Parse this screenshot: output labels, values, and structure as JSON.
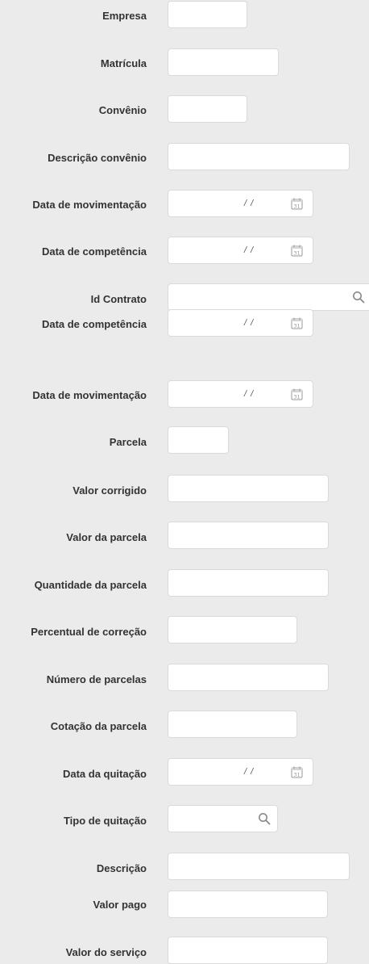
{
  "form": {
    "empresa": {
      "label": "Empresa",
      "value": ""
    },
    "matricula": {
      "label": "Matrícula",
      "value": ""
    },
    "convenio": {
      "label": "Convênio",
      "value": ""
    },
    "descricao_convenio": {
      "label": "Descrição convênio",
      "value": ""
    },
    "data_movimentacao_1": {
      "label": "Data de movimentação",
      "value": " / /"
    },
    "data_competencia_1": {
      "label": "Data de competência",
      "value": " / /"
    },
    "id_contrato": {
      "label": "Id Contrato",
      "value": ""
    },
    "data_competencia_2": {
      "label": "Data de competência",
      "value": " / /"
    },
    "data_movimentacao_2": {
      "label": "Data de movimentação",
      "value": " / /"
    },
    "parcela": {
      "label": "Parcela",
      "value": ""
    },
    "valor_corrigido": {
      "label": "Valor corrigido",
      "value": ""
    },
    "valor_parcela": {
      "label": "Valor da parcela",
      "value": ""
    },
    "quantidade_parcela": {
      "label": "Quantidade da parcela",
      "value": ""
    },
    "percentual_correcao": {
      "label": "Percentual de correção",
      "value": ""
    },
    "numero_parcelas": {
      "label": "Número de parcelas",
      "value": ""
    },
    "cotacao_parcela": {
      "label": "Cotação da parcela",
      "value": ""
    },
    "data_quitacao": {
      "label": "Data da quitação",
      "value": " / /"
    },
    "tipo_quitacao": {
      "label": "Tipo de quitação",
      "value": ""
    },
    "descricao": {
      "label": "Descrição",
      "value": ""
    },
    "valor_pago": {
      "label": "Valor pago",
      "value": ""
    },
    "valor_servico": {
      "label": "Valor do serviço",
      "value": ""
    }
  },
  "icons": {
    "calendar": "calendar-icon",
    "search": "search-icon"
  },
  "colors": {
    "background": "#ebebeb",
    "field_background": "#ffffff",
    "field_border": "#dadada",
    "label_text": "#333333",
    "icon": "#9a9a9a"
  }
}
